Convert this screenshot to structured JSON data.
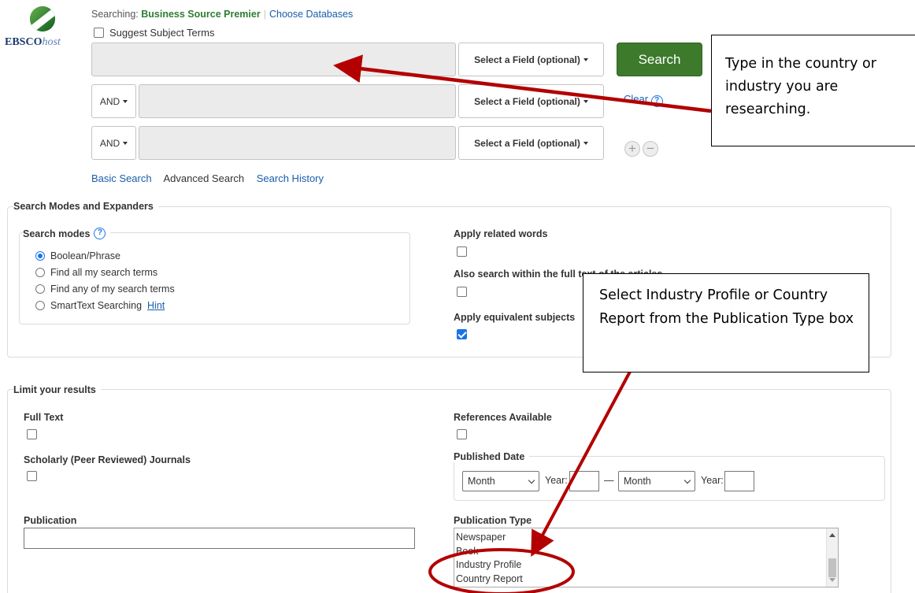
{
  "logo": {
    "brand": "EBSCO",
    "brand_suffix": "host"
  },
  "header": {
    "searching_label": "Searching:",
    "database": "Business Source Premier",
    "choose_databases": "Choose Databases",
    "suggest_subject_terms": "Suggest Subject Terms"
  },
  "search_rows": [
    {
      "operator": "",
      "field_select": "Select a Field (optional)",
      "value": ""
    },
    {
      "operator": "AND",
      "field_select": "Select a Field (optional)",
      "value": ""
    },
    {
      "operator": "AND",
      "field_select": "Select a Field (optional)",
      "value": ""
    }
  ],
  "buttons": {
    "search": "Search",
    "clear": "Clear",
    "help": "?",
    "plus": "+",
    "minus": "−"
  },
  "search_links": {
    "basic": "Basic Search",
    "advanced": "Advanced Search",
    "history": "Search History"
  },
  "modes_section": {
    "title": "Search Modes and Expanders",
    "search_modes_label": "Search modes",
    "modes": [
      {
        "label": "Boolean/Phrase",
        "selected": true
      },
      {
        "label": "Find all my search terms",
        "selected": false
      },
      {
        "label": "Find any of my search terms",
        "selected": false
      },
      {
        "label": "SmartText Searching",
        "selected": false
      }
    ],
    "hint": "Hint",
    "apply_related_words": "Apply related words",
    "apply_related_words_checked": false,
    "also_search_full_text": "Also search within the full text of the articles",
    "also_search_full_text_checked": false,
    "apply_equivalent_subjects": "Apply equivalent subjects",
    "apply_equivalent_subjects_checked": true
  },
  "limit_section": {
    "title": "Limit your results",
    "full_text": "Full Text",
    "full_text_checked": false,
    "scholarly": "Scholarly (Peer Reviewed) Journals",
    "scholarly_checked": false,
    "references_available": "References Available",
    "references_available_checked": false,
    "published_date": "Published Date",
    "month_from": "Month",
    "year_label": "Year:",
    "year_from": "",
    "dash": "—",
    "month_to": "Month",
    "year_to": "",
    "publication": "Publication",
    "publication_value": "",
    "publication_type": "Publication Type",
    "publication_type_options": [
      "Newspaper",
      "Book",
      "Industry Profile",
      "Country Report"
    ]
  },
  "annotations": {
    "callout_top": "Type in the country or industry you are researching.",
    "callout_mid": "Select Industry Profile or Country Report from the Publication Type box",
    "arrow_color": "#b30000"
  },
  "colors": {
    "search_button": "#3d7a2c",
    "link": "#1a5dab",
    "database": "#2e7d32"
  }
}
